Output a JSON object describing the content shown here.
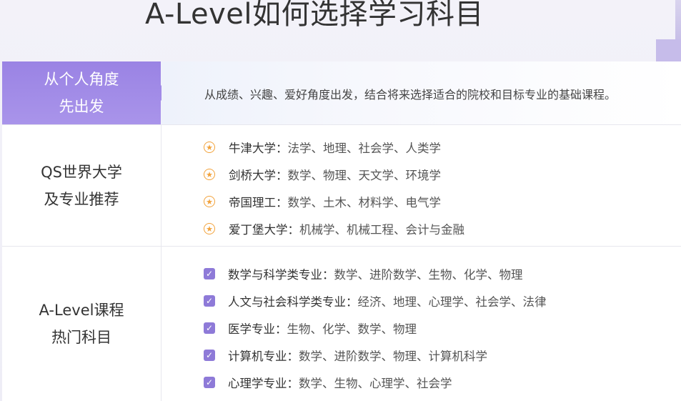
{
  "title": "A-Level如何选择学习科目",
  "rows": [
    {
      "label": "从个人角度\n先出发",
      "description": "从成绩、兴趣、爱好角度出发，结合将来选择适合的院校和目标专业的基础课程。"
    },
    {
      "label": "QS世界大学\n及专业推荐",
      "items": [
        {
          "name": "牛津大学：",
          "subjects": "法学、地理、社会学、人类学"
        },
        {
          "name": "剑桥大学：",
          "subjects": "数学、物理、天文学、环境学"
        },
        {
          "name": "帝国理工：",
          "subjects": "数学、土木、材料学、电气学"
        },
        {
          "name": "爱丁堡大学：",
          "subjects": "机械学、机械工程、会计与金融"
        }
      ]
    },
    {
      "label": "A-Level课程\n热门科目",
      "items": [
        {
          "name": "数学与科学类专业：",
          "subjects": "数学、进阶数学、生物、化学、物理"
        },
        {
          "name": "人文与社会科学类专业：",
          "subjects": "经济、地理、心理学、社会学、法律"
        },
        {
          "name": "医学专业：",
          "subjects": "生物、化学、数学、物理"
        },
        {
          "name": "计算机专业：",
          "subjects": "数学、进阶数学、物理、计算机科学"
        },
        {
          "name": "心理学专业：",
          "subjects": "数学、生物、心理学、社会学"
        }
      ]
    }
  ],
  "icons": {
    "university": "star-icon",
    "subject": "check-icon"
  },
  "colors": {
    "accent": "#9a83e4",
    "star": "#f2a23a",
    "check": "#8e7ad8"
  }
}
